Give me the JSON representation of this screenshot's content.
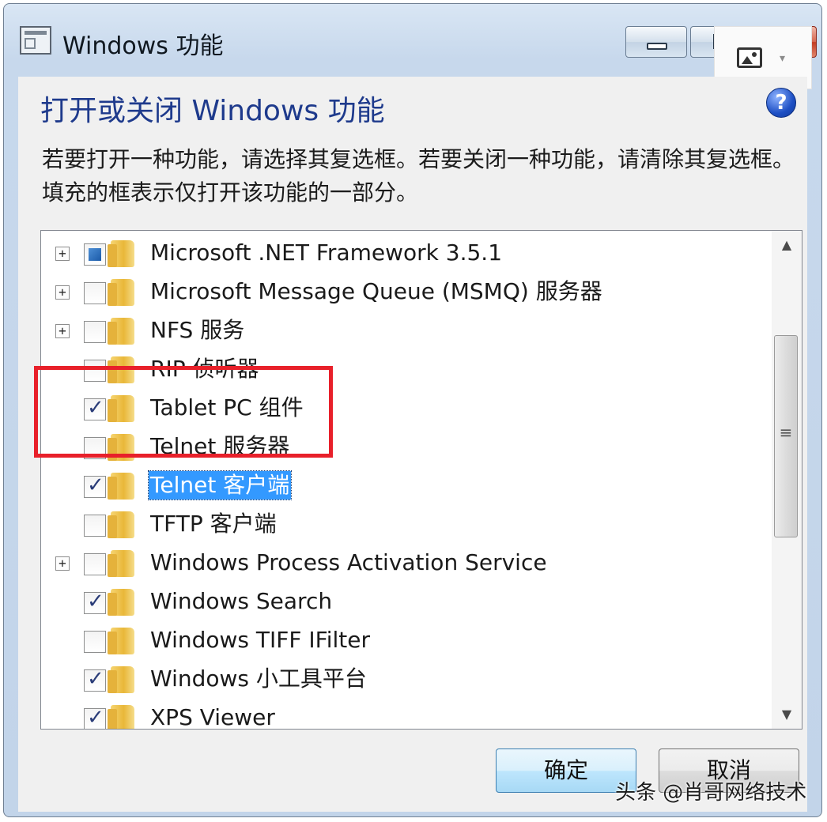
{
  "window": {
    "title": "Windows 功能",
    "buttons": {
      "minimize": "minimize",
      "maximize": "maximize",
      "close": "×"
    }
  },
  "dialog": {
    "heading": "打开或关闭 Windows 功能",
    "help": "?",
    "description": "若要打开一种功能，请选择其复选框。若要关闭一种功能，请清除其复选框。填充的框表示仅打开该功能的一部分。"
  },
  "features": [
    {
      "label": "Microsoft .NET Framework 3.5.1",
      "expandable": true,
      "state": "partial"
    },
    {
      "label": "Microsoft Message Queue (MSMQ) 服务器",
      "expandable": true,
      "state": "unchecked"
    },
    {
      "label": "NFS 服务",
      "expandable": true,
      "state": "unchecked"
    },
    {
      "label": "RIP 侦听器",
      "expandable": false,
      "state": "unchecked"
    },
    {
      "label": "Tablet PC 组件",
      "expandable": false,
      "state": "checked"
    },
    {
      "label": "Telnet 服务器",
      "expandable": false,
      "state": "unchecked"
    },
    {
      "label": "Telnet 客户端",
      "expandable": false,
      "state": "checked",
      "selected": true
    },
    {
      "label": "TFTP 客户端",
      "expandable": false,
      "state": "unchecked"
    },
    {
      "label": "Windows Process Activation Service",
      "expandable": true,
      "state": "unchecked"
    },
    {
      "label": "Windows Search",
      "expandable": false,
      "state": "checked"
    },
    {
      "label": "Windows TIFF IFilter",
      "expandable": false,
      "state": "unchecked"
    },
    {
      "label": "Windows 小工具平台",
      "expandable": false,
      "state": "checked"
    },
    {
      "label": "XPS Viewer",
      "expandable": false,
      "state": "checked"
    }
  ],
  "scrollbar": {
    "up": "▲",
    "down": "▼",
    "grip": "≡"
  },
  "actions": {
    "ok_label": "确定",
    "cancel_label": "取消"
  },
  "watermark": "头条 @肖哥网络技术",
  "colors": {
    "heading": "#1e3a8c",
    "selection": "#3399ff",
    "highlight": "#e8202a"
  }
}
